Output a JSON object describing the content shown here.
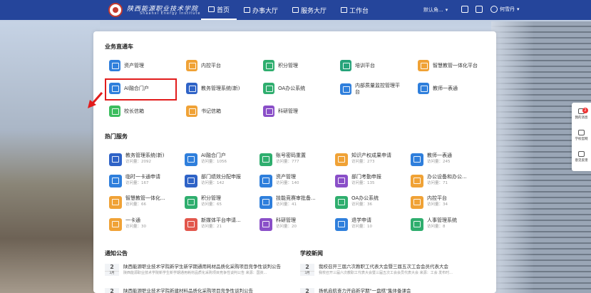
{
  "header": {
    "school_name": "陕西能源职业技术学院",
    "school_en": "Shaanxi Energy Institute",
    "nav": [
      {
        "label": "首页",
        "active": true
      },
      {
        "label": "办事大厅"
      },
      {
        "label": "服务大厅"
      },
      {
        "label": "工作台"
      }
    ],
    "role": "默认角...",
    "user": "何雪丹"
  },
  "business": {
    "title": "业务直通车",
    "items": [
      {
        "label": "资产管理",
        "color": "#2f7fdc"
      },
      {
        "label": "内控平台",
        "color": "#f0a236"
      },
      {
        "label": "积分管理",
        "color": "#2fae6e"
      },
      {
        "label": "培训平台",
        "color": "#26a37a"
      },
      {
        "label": "智慧教管一体化平台",
        "color": "#f0a236"
      },
      {
        "label": "AI融合门户",
        "color": "#2f7fdc"
      },
      {
        "label": "教务管理系统(新)",
        "color": "#2f63c7"
      },
      {
        "label": "OA办公系统",
        "color": "#2fae6e"
      },
      {
        "label": "内部质量监控管理平台",
        "color": "#2f7fdc"
      },
      {
        "label": "教师一表通",
        "color": "#2f7fdc"
      },
      {
        "label": "校长信箱",
        "color": "#3bbd5e"
      },
      {
        "label": "书记信箱",
        "color": "#f0a236"
      },
      {
        "label": "科研管理",
        "color": "#8a4fc8"
      }
    ]
  },
  "hot": {
    "title": "热门服务",
    "items": [
      {
        "name": "教务管理系统(新)",
        "visits": "访问量：2092",
        "color": "#2f63c7"
      },
      {
        "name": "AI融合门户",
        "visits": "访问量：1056",
        "color": "#2f7fdc"
      },
      {
        "name": "账号密码重置",
        "visits": "访问量：777",
        "color": "#2fae6e"
      },
      {
        "name": "知识产权成果申请",
        "visits": "访问量：273",
        "color": "#f0a236"
      },
      {
        "name": "教师一表通",
        "visits": "访问量：245",
        "color": "#2f7fdc"
      },
      {
        "name": "临时一卡通申请",
        "visits": "访问量：167",
        "color": "#2f7fdc"
      },
      {
        "name": "部门绩效分配申报",
        "visits": "访问量：142",
        "color": "#2f63c7"
      },
      {
        "name": "资产管理",
        "visits": "访问量：140",
        "color": "#2f7fdc"
      },
      {
        "name": "部门考勤申报",
        "visits": "访问量：135",
        "color": "#8a4fc8"
      },
      {
        "name": "办公设备和办公...",
        "visits": "访问量：71",
        "color": "#f0a236"
      },
      {
        "name": "智慧教管一体化...",
        "visits": "访问量：66",
        "color": "#f0a236"
      },
      {
        "name": "积分管理",
        "visits": "访问量：65",
        "color": "#2fae6e"
      },
      {
        "name": "技能竞赛审批备...",
        "visits": "访问量：41",
        "color": "#2f7fdc"
      },
      {
        "name": "OA办公系统",
        "visits": "访问量：36",
        "color": "#2fae6e"
      },
      {
        "name": "内控平台",
        "visits": "访问量：34",
        "color": "#f0a236"
      },
      {
        "name": "一卡通",
        "visits": "访问量：30",
        "color": "#f0a236"
      },
      {
        "name": "新媒体平台申请...",
        "visits": "访问量：21",
        "color": "#e2574c"
      },
      {
        "name": "科研管理",
        "visits": "访问量：20",
        "color": "#8a4fc8"
      },
      {
        "name": "退学申请",
        "visits": "访问量：10",
        "color": "#2f7fdc"
      },
      {
        "name": "人事管理系统",
        "visits": "访问量：8",
        "color": "#2fae6e"
      }
    ]
  },
  "notices": {
    "title": "通知公告",
    "items": [
      {
        "day": "2",
        "month": "3月",
        "title": "陕西能源职业技术学院新学生新学期通用耗材品质化采购项目竞争性谈判公告",
        "summary": "陕西能源职业技术学院新学生新学期通用耗材品质化采购项目竞争性谈判公告 来源：国资..."
      },
      {
        "day": "2",
        "month": "3月",
        "title": "陕西能源职业技术学院新建材料品质化采购项目竞争性谈判公告",
        "summary": ""
      }
    ]
  },
  "news": {
    "title": "学校新闻",
    "items": [
      {
        "day": "2",
        "month": "3月",
        "title": "我校召开三届六次教职工代表大会暨三届五次工会会员代表大会",
        "summary": "我校召开三届六次教职工代表大会暨三届五次工会会员代表大会 来源：工会 发布时..."
      },
      {
        "day": "2",
        "month": "3月",
        "title": "扬帆启航奋力开启新学期\"一盘棋\"集体备课会",
        "summary": ""
      }
    ]
  },
  "sidebar": {
    "items": [
      {
        "label": "我的消息",
        "badge": "2"
      },
      {
        "label": "学校官网"
      },
      {
        "label": "意见反馈"
      }
    ]
  }
}
